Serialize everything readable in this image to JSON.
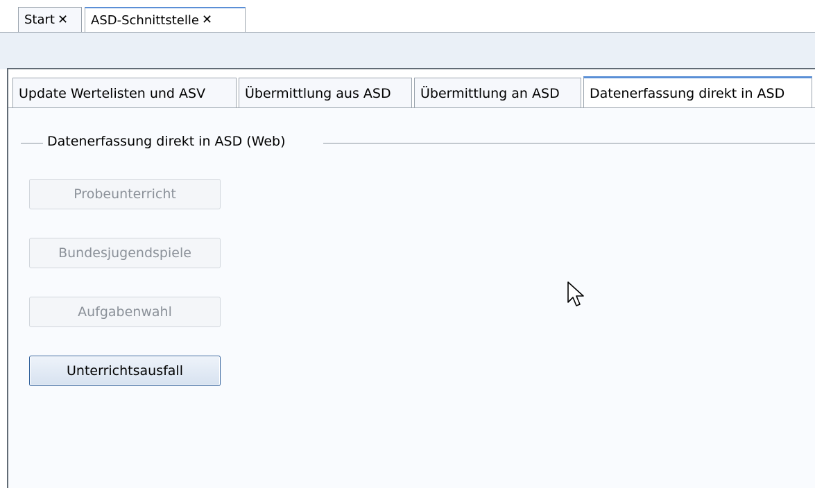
{
  "doc_tabs": [
    {
      "label": "Start",
      "close": "✕"
    },
    {
      "label": "ASD-Schnittstelle",
      "close": "✕"
    }
  ],
  "sub_tabs": [
    "Update Wertelisten und ASV",
    "Übermittlung aus ASD",
    "Übermittlung an ASD",
    "Datenerfassung direkt in ASD"
  ],
  "group": {
    "title": "Datenerfassung direkt in ASD (Web)"
  },
  "buttons": [
    {
      "label": "Probeunterricht",
      "enabled": false
    },
    {
      "label": "Bundesjugendspiele",
      "enabled": false
    },
    {
      "label": "Aufgabenwahl",
      "enabled": false
    },
    {
      "label": "Unterrichtsausfall",
      "enabled": true
    }
  ],
  "colors": {
    "accent": "#5a8fd6",
    "disabled_text": "#8b9199"
  }
}
